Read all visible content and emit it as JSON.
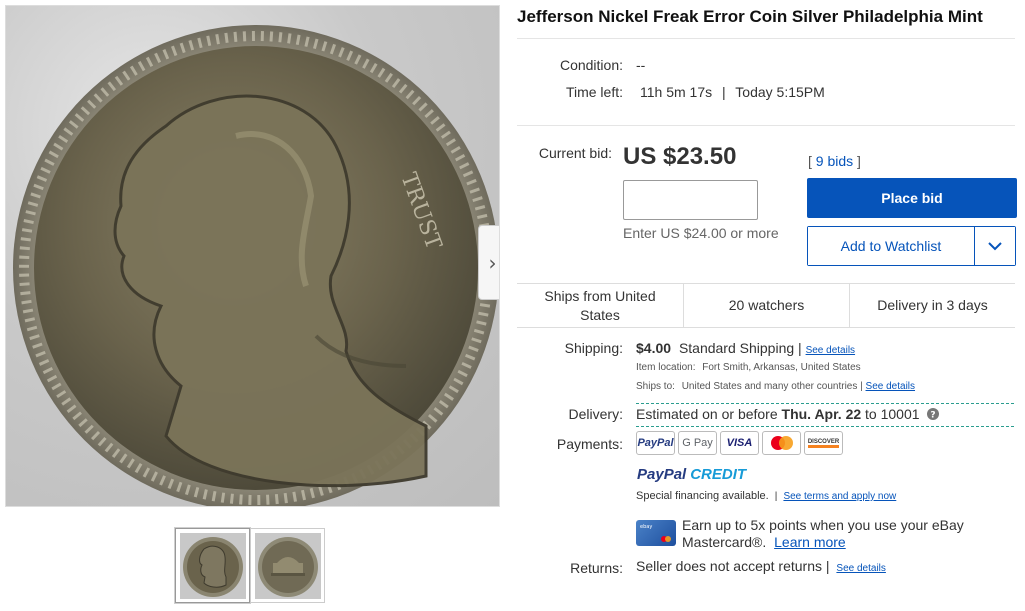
{
  "item": {
    "title": "Jefferson Nickel Freak Error Coin Silver Philadelphia Mint"
  },
  "condition": {
    "label": "Condition:",
    "value": "--"
  },
  "time_left": {
    "label": "Time left:",
    "value": "11h 5m 17s",
    "end": "Today 5:15PM"
  },
  "bid": {
    "label": "Current bid:",
    "price": "US $23.50",
    "bids_count": "9 bids",
    "input_value": "",
    "hint": "Enter US $24.00 or more",
    "place_bid_label": "Place bid",
    "watchlist_label": "Add to Watchlist"
  },
  "info_strip": {
    "ships_from": "Ships from United States",
    "watchers": "20 watchers",
    "delivery": "Delivery in 3 days"
  },
  "shipping": {
    "label": "Shipping:",
    "price": "$4.00",
    "method": "Standard Shipping",
    "see_details": "See details",
    "item_location_label": "Item location:",
    "item_location": "Fort Smith, Arkansas, United States",
    "ships_to_label": "Ships to:",
    "ships_to": "United States and many other countries",
    "ships_to_details": "See details"
  },
  "delivery": {
    "label": "Delivery:",
    "prefix": "Estimated on or before",
    "date": "Thu. Apr. 22",
    "suffix": "to 10001"
  },
  "payments": {
    "label": "Payments:",
    "methods": [
      "PayPal",
      "G Pay",
      "VISA",
      "Mastercard",
      "DISCOVER"
    ],
    "paypal_credit_a": "PayPal",
    "paypal_credit_b": "CREDIT",
    "financing": "Special financing available.",
    "financing_link": "See terms and apply now",
    "mc_promo_line1": "Earn up to 5x points when you use your eBay",
    "mc_promo_line2": "Mastercard®.",
    "mc_learn_more": "Learn more"
  },
  "returns": {
    "label": "Returns:",
    "value": "Seller does not accept returns",
    "see_details": "See details"
  },
  "colors": {
    "primary_blue": "#0654ba",
    "dashed_teal": "#2a9d8f",
    "paypal_dark": "#253b80",
    "paypal_light": "#179bd7"
  },
  "icons": {
    "next": "chevron-right-icon",
    "dropdown": "chevron-down-icon",
    "help": "question-circle-icon"
  }
}
